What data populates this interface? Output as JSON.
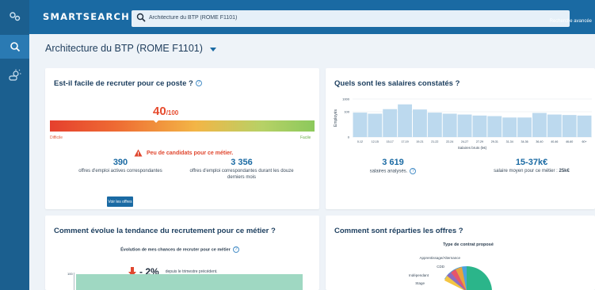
{
  "app": {
    "brand": "SMARTSEARCH",
    "search_value": "Architecture du BTP (ROME F1101)",
    "advanced_link": "Recherche avancée"
  },
  "page": {
    "title": "Architecture du BTP (ROME F1101)"
  },
  "recruit_card": {
    "title": "Est-il facile de recruter pour ce poste ?",
    "score": "40",
    "score_suffix": "/100",
    "score_fraction": 0.4,
    "left_label": "Difficile",
    "right_label": "Facile",
    "alert": "Peu de candidats pour ce métier.",
    "stat1_value": "390",
    "stat1_label": "offres d'emploi actives correspondantes",
    "stat2_value": "3 356",
    "stat2_label": "offres d'emploi correspondantes durant les douze derniers mois",
    "button_label": "Voir les offres"
  },
  "salary_card": {
    "title": "Quels sont les salaires constatés ?",
    "stat1_value": "3 619",
    "stat1_label": "salaires analysés.",
    "stat2_value": "15-37k€",
    "stat2_label_prefix": "salaire moyen pour ce métier : ",
    "stat2_label_strong": "25k€"
  },
  "trend_card": {
    "title": "Comment évolue la tendance du recrutement pour ce métier ?",
    "subtitle": "Évolution de mes chances de recruter pour ce métier",
    "value": "- 2%",
    "caption": "depuis le trimestre précédent.",
    "y_tick": "100"
  },
  "offers_card": {
    "title": "Comment sont réparties les offres ?",
    "subtitle": "Type de contrat proposé",
    "legend": [
      "Apprentissage/Alternance",
      "CDD",
      "Indépendant",
      "Stage"
    ]
  },
  "colors": {
    "brand_blue": "#1a6aa3",
    "rail_blue": "#1b5f8f",
    "alert_red": "#e0472f",
    "teal": "#2bb58a"
  },
  "icons": {
    "rail": [
      "settings-gear-icon",
      "search-icon",
      "sun-cloud-icon"
    ],
    "alert": "warning-triangle-icon",
    "trend": "down-arrow-icon"
  },
  "chart_data": {
    "type": "bar",
    "categories": [
      "0-12",
      "12-15",
      "15-17",
      "17-19",
      "19-21",
      "21-22",
      "22-24",
      "24-27",
      "27-29",
      "29-31",
      "31-34",
      "34-36",
      "36-40",
      "40-46",
      "46-60",
      "60+"
    ],
    "values": [
      85,
      70,
      160,
      380,
      150,
      85,
      70,
      60,
      50,
      45,
      35,
      35,
      80,
      60,
      55,
      50
    ],
    "xlabel": "Salaires bruts (k€)",
    "ylabel": "Employés",
    "yticks": [
      "1000",
      "100",
      "0"
    ],
    "yticks_values": [
      1000,
      100,
      1
    ],
    "y_scale": "log",
    "ylim": [
      1,
      1000
    ]
  }
}
